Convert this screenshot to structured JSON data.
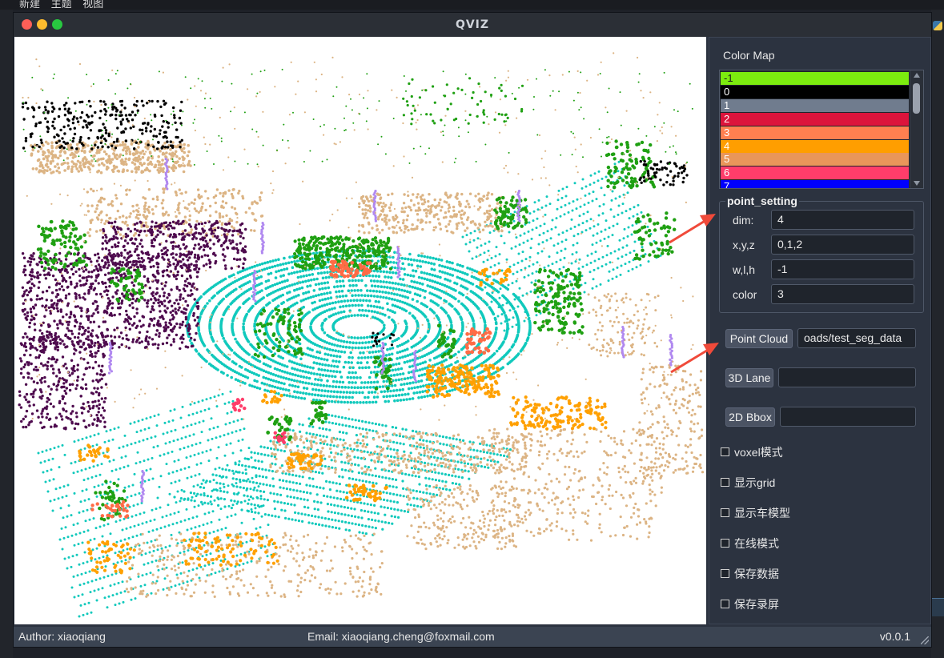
{
  "desktop": {
    "menu": [
      "新建",
      "主题",
      "视图"
    ]
  },
  "window": {
    "title": "QVIZ"
  },
  "colormap": {
    "label": "Color Map",
    "items": [
      {
        "label": "-1",
        "color": "#7ceb0f",
        "text_color": "#1a1a1a"
      },
      {
        "label": "0",
        "color": "#000000",
        "text_color": "#ffffff"
      },
      {
        "label": "1",
        "color": "#707c8e",
        "text_color": "#ffffff"
      },
      {
        "label": "2",
        "color": "#dc143c",
        "text_color": "#ffffff"
      },
      {
        "label": "3",
        "color": "#ff7f50",
        "text_color": "#ffffff"
      },
      {
        "label": "4",
        "color": "#ff9e00",
        "text_color": "#ffffff"
      },
      {
        "label": "5",
        "color": "#e9965a",
        "text_color": "#ffffff"
      },
      {
        "label": "6",
        "color": "#ff3d6a",
        "text_color": "#ffffff"
      },
      {
        "label": "7",
        "color": "#0000ff",
        "text_color": "#ffffff"
      }
    ]
  },
  "point_setting": {
    "title": "point_setting",
    "fields": [
      {
        "label": "dim:",
        "value": "4"
      },
      {
        "label": "x,y,z",
        "value": "0,1,2"
      },
      {
        "label": "w,l,h",
        "value": "-1"
      },
      {
        "label": "color",
        "value": "3"
      }
    ]
  },
  "loaders": [
    {
      "button": "Point Cloud",
      "value": "oads/test_seg_data"
    },
    {
      "button": "3D Lane",
      "value": ""
    },
    {
      "button": "2D Bbox",
      "value": ""
    }
  ],
  "options": [
    "voxel模式",
    "显示grid",
    "显示车模型",
    "在线模式",
    "保存数据",
    "保存录屏"
  ],
  "status": {
    "author": "Author: xiaoqiang",
    "email": "Email: xiaoqiang.cheng@foxmail.com",
    "version": "v0.0.1"
  },
  "viewer": {
    "background": "#ffffff",
    "classes": {
      "ground": "#10c9bc",
      "vegetation": "#1fa012",
      "building": "#dcb484",
      "terrain": "#4e0b4e",
      "vehicle": "#ffa000",
      "pole": "#b088f0",
      "unlabeled": "#000000",
      "person": "#ff3d6a",
      "car_red": "#ff6b45"
    }
  },
  "annotation_color": "#f04a3a"
}
